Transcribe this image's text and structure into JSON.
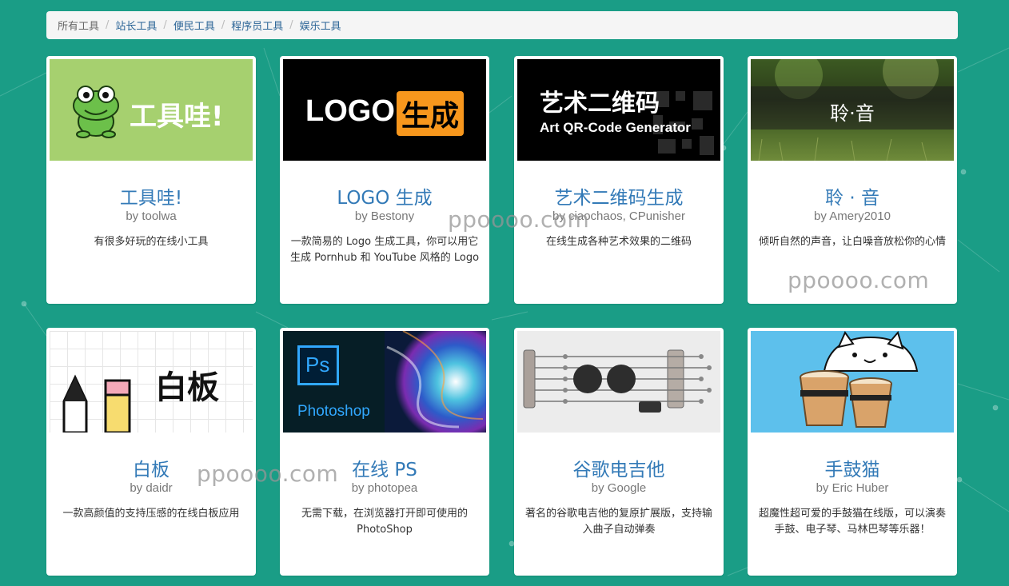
{
  "breadcrumb": [
    "所有工具",
    "站长工具",
    "便民工具",
    "程序员工具",
    "娱乐工具"
  ],
  "watermark": "ppoooo.com",
  "cards": [
    {
      "title": "工具哇!",
      "author": "by toolwa",
      "desc": "有很多好玩的在线小工具",
      "thumb_text": "工具哇!",
      "thumb_icon": "frog-icon"
    },
    {
      "title": "LOGO 生成",
      "author": "by Bestony",
      "desc": "一款简易的 Logo 生成工具，你可以用它生成 Pornhub 和 YouTube 风格的 Logo",
      "thumb_text_a": "LOGO",
      "thumb_text_b": "生成"
    },
    {
      "title": "艺术二维码生成",
      "author": "by ciaochaos, CPunisher",
      "desc": "在线生成各种艺术效果的二维码",
      "thumb_text_a": "艺术二维码",
      "thumb_text_b": "Art QR-Code Generator"
    },
    {
      "title": "聆 · 音",
      "author": "by Amery2010",
      "desc": "倾听自然的声音，让白噪音放松你的心情",
      "thumb_text": "聆·音"
    },
    {
      "title": "白板",
      "author": "by daidr",
      "desc": "一款高颜值的支持压感的在线白板应用",
      "thumb_text": "白板",
      "thumb_icon": "pencil-icon"
    },
    {
      "title": "在线 PS",
      "author": "by photopea",
      "desc": "无需下载，在浏览器打开即可使用的 PhotoShop",
      "thumb_text_a": "Ps",
      "thumb_text_b": "Photoshop"
    },
    {
      "title": "谷歌电吉他",
      "author": "by Google",
      "desc": "著名的谷歌电吉他的复原扩展版，支持输入曲子自动弹奏",
      "thumb_icon": "guitar-icon"
    },
    {
      "title": "手鼓猫",
      "author": "by Eric Huber",
      "desc": "超魔性超可爱的手鼓猫在线版，可以演奏手鼓、电子琴、马林巴琴等乐器！",
      "thumb_icon": "bongo-cat-icon"
    }
  ],
  "colors": {
    "background": "#1a9d86",
    "link": "#337ab7",
    "frog_bg": "#a6d06f",
    "ps_blue": "#31a8ff",
    "logo_orange": "#f7971d"
  }
}
